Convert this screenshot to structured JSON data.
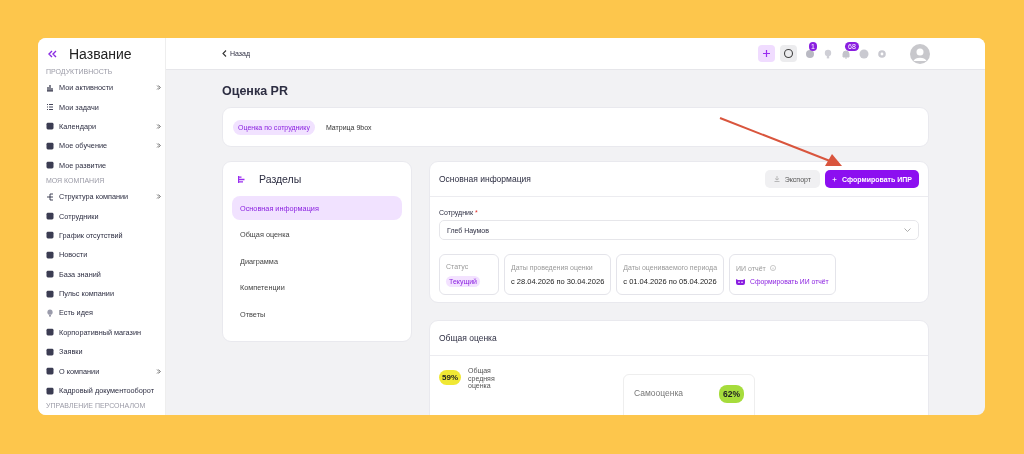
{
  "sidebar": {
    "title": "Название",
    "items": [
      {
        "kind": "section",
        "label": "ПРОДУКТИВНОСТЬ"
      },
      {
        "kind": "item",
        "label": "Мои активности",
        "submenu": true
      },
      {
        "kind": "item",
        "label": "Мои задачи",
        "submenu": false
      },
      {
        "kind": "item",
        "label": "Календари",
        "submenu": true
      },
      {
        "kind": "item",
        "label": "Мое обучение",
        "submenu": true
      },
      {
        "kind": "item",
        "label": "Мое развитие",
        "submenu": false
      },
      {
        "kind": "section",
        "label": "МОЯ КОМПАНИЯ"
      },
      {
        "kind": "item",
        "label": "Структура компании",
        "submenu": true
      },
      {
        "kind": "item",
        "label": "Сотрудники",
        "submenu": false
      },
      {
        "kind": "item",
        "label": "График отсутствий",
        "submenu": false
      },
      {
        "kind": "item",
        "label": "Новости",
        "submenu": false
      },
      {
        "kind": "item",
        "label": "База знаний",
        "submenu": false
      },
      {
        "kind": "item",
        "label": "Пульс компании",
        "submenu": false
      },
      {
        "kind": "item",
        "label": "Есть идея",
        "submenu": false
      },
      {
        "kind": "item",
        "label": "Корпоративный магазин",
        "submenu": false
      },
      {
        "kind": "item",
        "label": "Заявки",
        "submenu": false
      },
      {
        "kind": "item",
        "label": "О компании",
        "submenu": true
      },
      {
        "kind": "item",
        "label": "Кадровый документооборот",
        "submenu": false
      },
      {
        "kind": "section",
        "label": "УПРАВЛЕНИЕ ПЕРСОНАЛОМ"
      }
    ]
  },
  "topbar": {
    "back": "Назад",
    "chat_badge": "1",
    "bell_badge": "68"
  },
  "page_title": "Оценка PR",
  "tabs": [
    {
      "label": "Оценка по сотруднику",
      "selected": true
    },
    {
      "label": "Матрица 9box",
      "selected": false
    }
  ],
  "sections": {
    "title": "Разделы",
    "items": [
      {
        "label": "Основная информация",
        "selected": true
      },
      {
        "label": "Общая оценка",
        "selected": false
      },
      {
        "label": "Диаграмма",
        "selected": false
      },
      {
        "label": "Компетенции",
        "selected": false
      },
      {
        "label": "Ответы",
        "selected": false
      }
    ]
  },
  "main_info": {
    "title": "Основная информация",
    "export_button": "Экспорт",
    "create_button": "Сформировать ИПР",
    "employee_label": "Сотрудник",
    "required_mark": "*",
    "employee_value": "Глеб Наумов",
    "status_label": "Статус",
    "status_value": "Текущий",
    "dates": [
      {
        "label": "Даты проведения оценки",
        "value": "с 28.04.2026 по 30.04.2026"
      },
      {
        "label": "Даты оцениваемого периода",
        "value": "с 01.04.2026 по 05.04.2026"
      }
    ],
    "ai_label": "ИИ отчёт",
    "ai_link": "Сформировать ИИ отчёт"
  },
  "overall": {
    "title": "Общая оценка",
    "score": "59%",
    "score_label": "Общая средняя оценка",
    "self_label": "Самооценка",
    "self_score": "62%"
  }
}
